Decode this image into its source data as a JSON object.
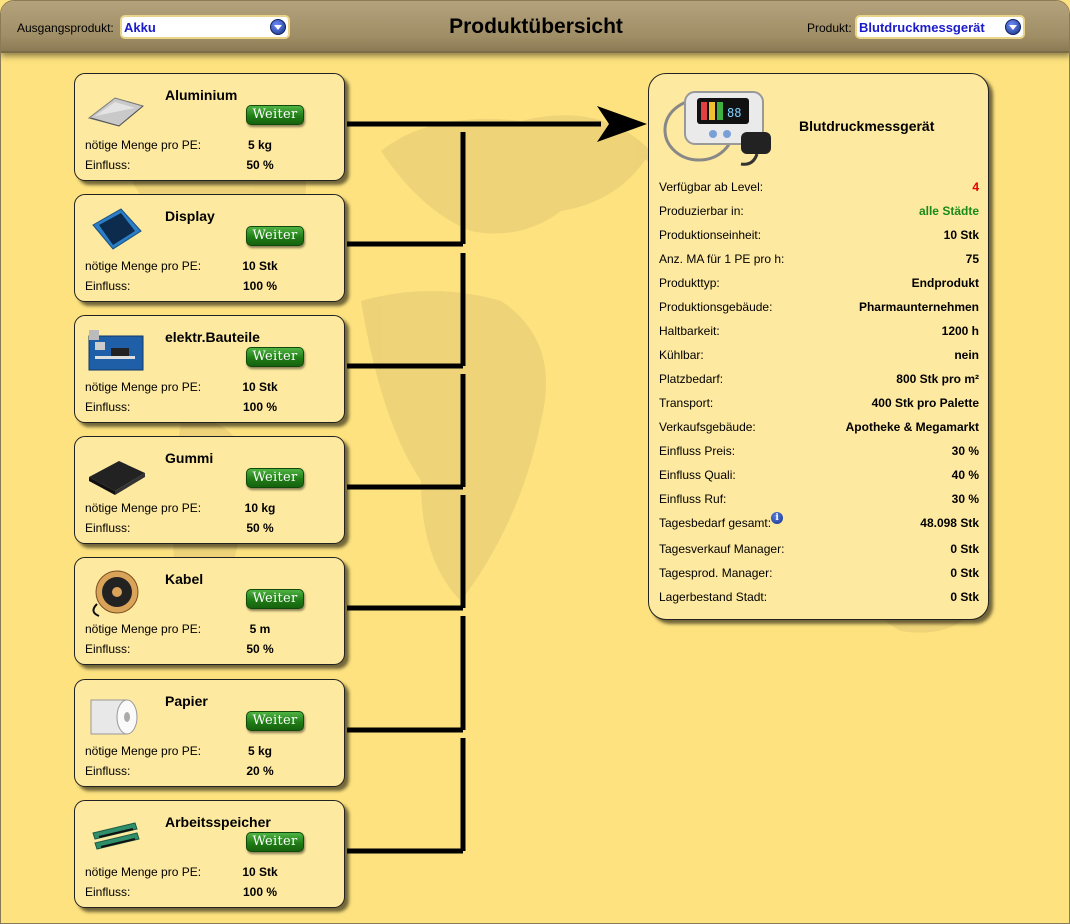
{
  "header": {
    "source_label": "Ausgangsprodukt:",
    "source_value": "Akku",
    "title": "Produktübersicht",
    "product_label": "Produkt:",
    "product_value": "Blutdruckmessgerät"
  },
  "weiter_label": "Weiter",
  "ingredients": [
    {
      "name": "Aluminium",
      "qty_label": "nötige Menge pro PE:",
      "qty": "5 kg",
      "influence_label": "Einfluss:",
      "influence": "50 %",
      "icon": "aluminium-foil-icon"
    },
    {
      "name": "Display",
      "qty_label": "nötige Menge pro PE:",
      "qty": "10 Stk",
      "influence_label": "Einfluss:",
      "influence": "100 %",
      "icon": "display-icon"
    },
    {
      "name": "elektr.Bauteile",
      "qty_label": "nötige Menge pro PE:",
      "qty": "10 Stk",
      "influence_label": "Einfluss:",
      "influence": "100 %",
      "icon": "circuit-board-icon"
    },
    {
      "name": "Gummi",
      "qty_label": "nötige Menge pro PE:",
      "qty": "10 kg",
      "influence_label": "Einfluss:",
      "influence": "50 %",
      "icon": "rubber-sheet-icon"
    },
    {
      "name": "Kabel",
      "qty_label": "nötige Menge pro PE:",
      "qty": "5 m",
      "influence_label": "Einfluss:",
      "influence": "50 %",
      "icon": "cable-reel-icon"
    },
    {
      "name": "Papier",
      "qty_label": "nötige Menge pro PE:",
      "qty": "5 kg",
      "influence_label": "Einfluss:",
      "influence": "20 %",
      "icon": "paper-roll-icon"
    },
    {
      "name": "Arbeitsspeicher",
      "qty_label": "nötige Menge pro PE:",
      "qty": "10 Stk",
      "influence_label": "Einfluss:",
      "influence": "100 %",
      "icon": "ram-module-icon"
    }
  ],
  "product": {
    "name": "Blutdruckmessgerät",
    "icon": "blood-pressure-monitor-icon",
    "rows": [
      {
        "key": "Verfügbar ab Level:",
        "value": "4",
        "color": "#e00000"
      },
      {
        "key": "Produzierbar in:",
        "value": "alle Städte",
        "color": "#1a8a1a"
      },
      {
        "key": "Produktionseinheit:",
        "value": "10 Stk"
      },
      {
        "key": "Anz. MA für 1 PE pro h:",
        "value": "75"
      },
      {
        "key": "Produkttyp:",
        "value": "Endprodukt"
      },
      {
        "key": "Produktionsgebäude:",
        "value": "Pharmaunternehmen"
      },
      {
        "key": "Haltbarkeit:",
        "value": "1200 h"
      },
      {
        "key": "Kühlbar:",
        "value": "nein"
      },
      {
        "key": "Platzbedarf:",
        "value": "800 Stk pro m²"
      },
      {
        "key": "Transport:",
        "value": "400 Stk pro Palette"
      },
      {
        "key": "Verkaufsgebäude:",
        "value": "Apotheke & Megamarkt"
      },
      {
        "key": "Einfluss Preis:",
        "value": "30 %"
      },
      {
        "key": "Einfluss Quali:",
        "value": "40 %"
      },
      {
        "key": "Einfluss Ruf:",
        "value": "30 %"
      },
      {
        "key": "Tagesbedarf gesamt:",
        "value": "48.098 Stk",
        "info": "i"
      },
      {
        "key": "Tagesverkauf Manager:",
        "value": "0 Stk"
      },
      {
        "key": "Tagesprod. Manager:",
        "value": "0 Stk"
      },
      {
        "key": "Lagerbestand Stadt:",
        "value": "0 Stk"
      }
    ]
  }
}
